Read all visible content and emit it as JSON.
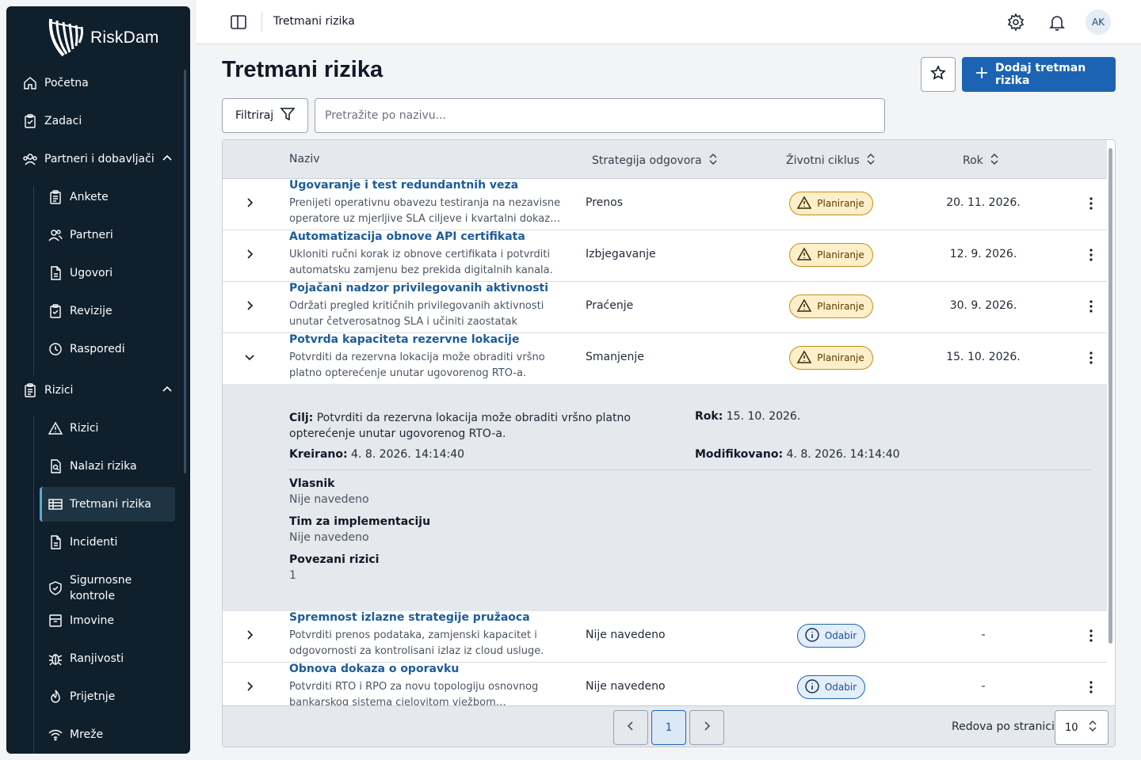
{
  "app": {
    "name": "RiskDam"
  },
  "sidebar": {
    "items": [
      {
        "label": "Početna",
        "icon": "home-icon"
      },
      {
        "label": "Zadaci",
        "icon": "clipboard-check-icon"
      },
      {
        "label": "Partneri i dobavljači",
        "icon": "users-group-icon",
        "expanded": true
      },
      {
        "label": "Ankete",
        "icon": "clipboard-list-icon"
      },
      {
        "label": "Partneri",
        "icon": "users-icon"
      },
      {
        "label": "Ugovori",
        "icon": "document-icon"
      },
      {
        "label": "Revizije",
        "icon": "clipboard-check-icon"
      },
      {
        "label": "Rasporedi",
        "icon": "clock-icon"
      },
      {
        "label": "Rizici",
        "icon": "clipboard-list-icon",
        "expanded": true
      },
      {
        "label": "Rizici",
        "icon": "warning-icon"
      },
      {
        "label": "Nalazi rizika",
        "icon": "document-search-icon"
      },
      {
        "label": "Tretmani rizika",
        "icon": "table-icon",
        "active": true
      },
      {
        "label": "Incidenti",
        "icon": "document-icon"
      },
      {
        "label": "Sigurnosne kontrole",
        "icon": "shield-check-icon"
      },
      {
        "label": "Imovine",
        "icon": "archive-icon"
      },
      {
        "label": "Ranjivosti",
        "icon": "bug-icon"
      },
      {
        "label": "Prijetnje",
        "icon": "fire-icon"
      },
      {
        "label": "Mreže",
        "icon": "wifi-icon"
      }
    ]
  },
  "topbar": {
    "breadcrumb": "Tretmani rizika",
    "avatar": "AK"
  },
  "page": {
    "title": "Tretmani rizika",
    "add_button": "Dodaj tretman rizika",
    "filter_button": "Filtriraj",
    "search_placeholder": "Pretražite po nazivu..."
  },
  "table": {
    "columns": [
      "Naziv",
      "Strategija odgovora",
      "Životni ciklus",
      "Rok"
    ],
    "rows": [
      {
        "title": "Ugovaranje i test redundantnih veza",
        "desc": "Prenijeti operativnu obavezu testiranja na nezavisne operatore uz mjerljive SLA ciljeve i kvartalni dokaz…",
        "strategy": "Prenos",
        "status": "Planiranje",
        "status_type": "warning",
        "due": "20. 11. 2026.",
        "expanded": false
      },
      {
        "title": "Automatizacija obnove API certifikata",
        "desc": "Ukloniti ručni korak iz obnove certifikata i potvrditi automatsku zamjenu bez prekida digitalnih kanala.",
        "strategy": "Izbjegavanje",
        "status": "Planiranje",
        "status_type": "warning",
        "due": "12. 9. 2026.",
        "expanded": false
      },
      {
        "title": "Pojačani nadzor privilegovanih aktivnosti",
        "desc": "Održati pregled kritičnih privilegovanih aktivnosti unutar četverosatnog SLA i učiniti zaostatak vidljivi…",
        "strategy": "Praćenje",
        "status": "Planiranje",
        "status_type": "warning",
        "due": "30. 9. 2026.",
        "expanded": false
      },
      {
        "title": "Potvrda kapaciteta rezervne lokacije",
        "desc": "Potvrditi da rezervna lokacija može obraditi vršno platno opterećenje unutar ugovorenog RTO-a.",
        "strategy": "Smanjenje",
        "status": "Planiranje",
        "status_type": "warning",
        "due": "15. 10. 2026.",
        "expanded": true
      },
      {
        "title": "Spremnost izlazne strategije pružaoca",
        "desc": "Potvrditi prenos podataka, zamjenski kapacitet i odgovornosti za kontrolisani izlaz iz cloud usluge.",
        "strategy": "Nije navedeno",
        "status": "Odabir",
        "status_type": "info",
        "due": "-",
        "expanded": false
      },
      {
        "title": "Obnova dokaza o oporavku",
        "desc": "Potvrditi RTO i RPO za novu topologiju osnovnog bankarskog sistema cjelovitom vježbom…",
        "strategy": "Nije navedeno",
        "status": "Odabir",
        "status_type": "info",
        "due": "-",
        "expanded": false
      }
    ]
  },
  "detail": {
    "goal_label": "Cilj:",
    "goal_text": "Potvrditi da rezervna lokacija može obraditi vršno platno opterećenje unutar ugovorenog RTO-a.",
    "due_label": "Rok:",
    "due_value": "15. 10. 2026.",
    "created_label": "Kreirano:",
    "created_value": "4. 8. 2026. 14:14:40",
    "modified_label": "Modifikovano:",
    "modified_value": "4. 8. 2026. 14:14:40",
    "owner_label": "Vlasnik",
    "owner_value": "Nije navedeno",
    "team_label": "Tim za implementaciju",
    "team_value": "Nije navedeno",
    "linked_label": "Povezani rizici",
    "linked_value": "1"
  },
  "pagination": {
    "current_page": "1",
    "rows_label": "Redova po stranici",
    "rows_value": "10"
  }
}
